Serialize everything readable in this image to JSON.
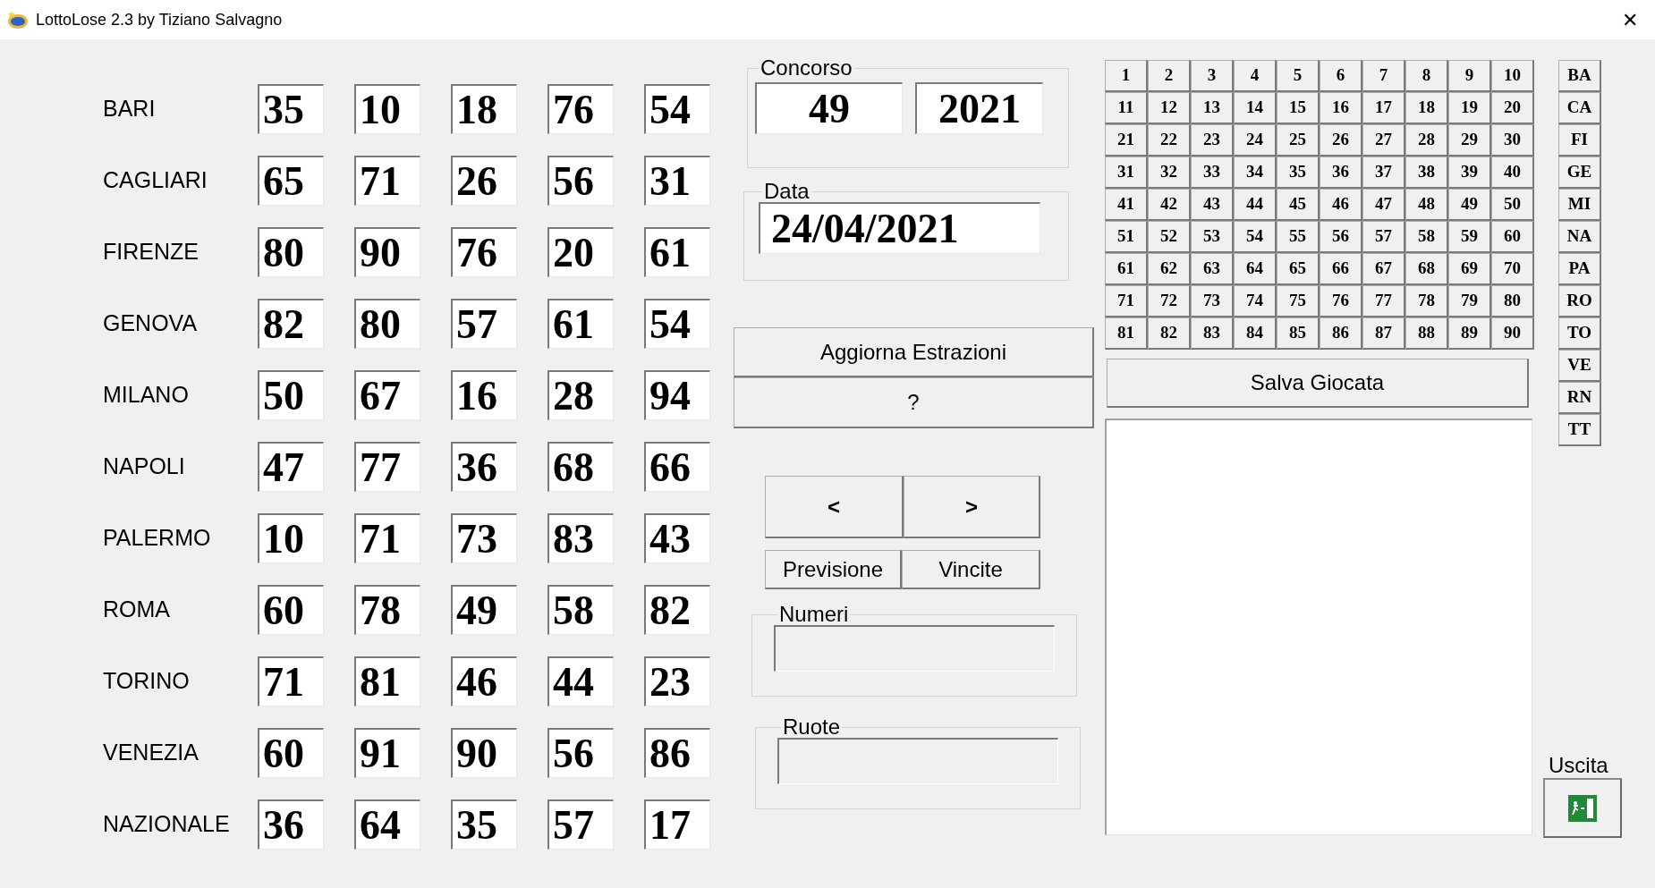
{
  "window": {
    "title": "LottoLose 2.3 by Tiziano Salvagno",
    "close": "✕"
  },
  "wheels": [
    {
      "name": "BARI",
      "numbers": [
        "35",
        "10",
        "18",
        "76",
        "54"
      ]
    },
    {
      "name": "CAGLIARI",
      "numbers": [
        "65",
        "71",
        "26",
        "56",
        "31"
      ]
    },
    {
      "name": "FIRENZE",
      "numbers": [
        "80",
        "90",
        "76",
        "20",
        "61"
      ]
    },
    {
      "name": "GENOVA",
      "numbers": [
        "82",
        "80",
        "57",
        "61",
        "54"
      ]
    },
    {
      "name": "MILANO",
      "numbers": [
        "50",
        "67",
        "16",
        "28",
        "94"
      ]
    },
    {
      "name": "NAPOLI",
      "numbers": [
        "47",
        "77",
        "36",
        "68",
        "66"
      ]
    },
    {
      "name": "PALERMO",
      "numbers": [
        "10",
        "71",
        "73",
        "83",
        "43"
      ]
    },
    {
      "name": "ROMA",
      "numbers": [
        "60",
        "78",
        "49",
        "58",
        "82"
      ]
    },
    {
      "name": "TORINO",
      "numbers": [
        "71",
        "81",
        "46",
        "44",
        "23"
      ]
    },
    {
      "name": "VENEZIA",
      "numbers": [
        "60",
        "91",
        "90",
        "56",
        "86"
      ]
    },
    {
      "name": "NAZIONALE",
      "numbers": [
        "36",
        "64",
        "35",
        "57",
        "17"
      ]
    }
  ],
  "concorso": {
    "label": "Concorso",
    "number": "49",
    "year": "2021"
  },
  "data": {
    "label": "Data",
    "value": "24/04/2021"
  },
  "update_button": "Aggiorna Estrazioni",
  "help_button": "?",
  "nav": {
    "prev": "<",
    "next": ">"
  },
  "tabs": [
    {
      "label": "Previsione",
      "selected": false
    },
    {
      "label": "Vincite",
      "selected": false
    }
  ],
  "numeri": {
    "label": "Numeri"
  },
  "ruote_field": {
    "label": "Ruote"
  },
  "number_grid": [
    "1",
    "2",
    "3",
    "4",
    "5",
    "6",
    "7",
    "8",
    "9",
    "10",
    "11",
    "12",
    "13",
    "14",
    "15",
    "16",
    "17",
    "18",
    "19",
    "20",
    "21",
    "22",
    "23",
    "24",
    "25",
    "26",
    "27",
    "28",
    "29",
    "30",
    "31",
    "32",
    "33",
    "34",
    "35",
    "36",
    "37",
    "38",
    "39",
    "40",
    "41",
    "42",
    "43",
    "44",
    "45",
    "46",
    "47",
    "48",
    "49",
    "50",
    "51",
    "52",
    "53",
    "54",
    "55",
    "56",
    "57",
    "58",
    "59",
    "60",
    "61",
    "62",
    "63",
    "64",
    "65",
    "66",
    "67",
    "68",
    "69",
    "70",
    "71",
    "72",
    "73",
    "74",
    "75",
    "76",
    "77",
    "78",
    "79",
    "80",
    "81",
    "82",
    "83",
    "84",
    "85",
    "86",
    "87",
    "88",
    "89",
    "90"
  ],
  "save_button": "Salva Giocata",
  "wheel_buttons": [
    "BA",
    "CA",
    "FI",
    "GE",
    "MI",
    "NA",
    "PA",
    "RO",
    "TO",
    "VE",
    "RN",
    "TT"
  ],
  "exit": {
    "label": "Uscita"
  }
}
